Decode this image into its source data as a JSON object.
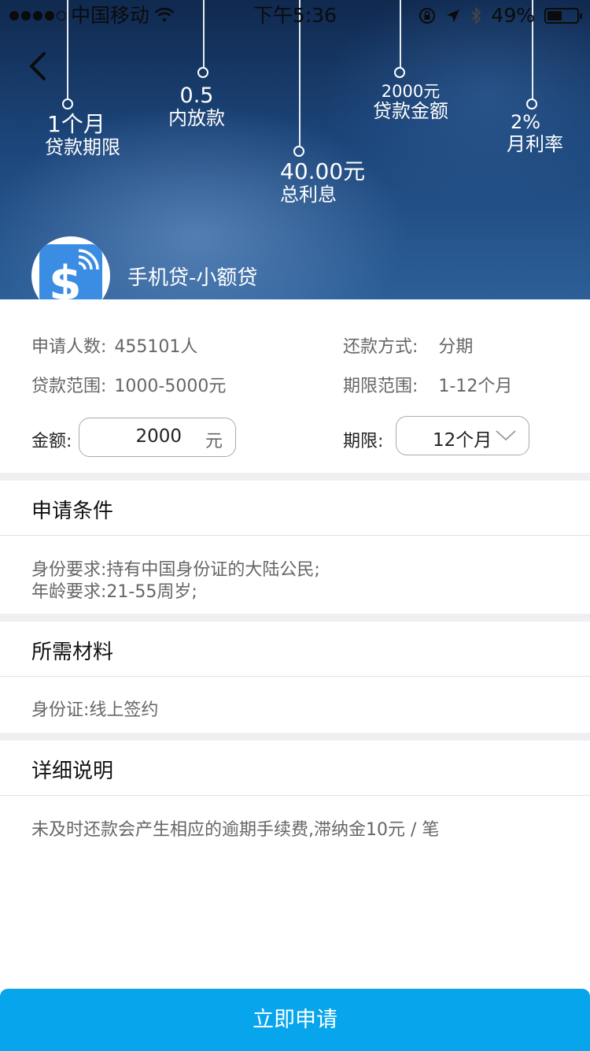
{
  "status_bar": {
    "carrier": "中国移动",
    "time": "下午5:36",
    "battery": "49%",
    "battery_level": 0.49,
    "icons": [
      "signal-dots-icon",
      "wifi-icon",
      "orientation-lock-icon",
      "location-arrow-icon",
      "bluetooth-icon",
      "battery-icon"
    ]
  },
  "nav": {
    "back_icon": "chevron-left-icon"
  },
  "hero": {
    "stats": [
      {
        "value": "1个月",
        "label": "贷款期限"
      },
      {
        "value": "0.5",
        "label": "内放款"
      },
      {
        "value": "40.00元",
        "label": "总利息"
      },
      {
        "value": "2000元",
        "label": "贷款金额"
      },
      {
        "value": "2%",
        "label": "月利率"
      }
    ],
    "product_name": "手机贷-小额贷",
    "product_logo_icon": "dollar-nfc-icon",
    "logo_color": "#3b8de3"
  },
  "info": {
    "applicants_label": "申请人数:",
    "applicants_value": "455101人",
    "repayment_label": "还款方式:",
    "repayment_value": "分期",
    "range_label": "贷款范围:",
    "range_value": "1000-5000元",
    "term_range_label": "期限范围:",
    "term_range_value": "1-12个月",
    "amount_label": "金额:",
    "amount_value": "2000",
    "amount_unit": "元",
    "term_label": "期限:",
    "term_value": "12个月"
  },
  "sections": {
    "conditions": {
      "title": "申请条件",
      "lines": [
        "身份要求:持有中国身份证的大陆公民;",
        "年龄要求:21-55周岁;"
      ]
    },
    "materials": {
      "title": "所需材料",
      "lines": [
        "身份证:线上签约"
      ]
    },
    "details": {
      "title": "详细说明",
      "lines": [
        "未及时还款会产生相应的逾期手续费,滞纳金10元 / 笔"
      ]
    }
  },
  "apply_button": {
    "label": "立即申请",
    "color": "#06a5ec"
  }
}
